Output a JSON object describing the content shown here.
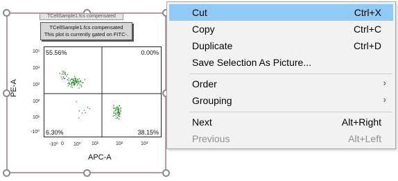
{
  "plot": {
    "header_text": "TCellSample1.fcs compensated",
    "notice_line1": "TCellSample1.fcs compensated",
    "notice_line2": "This plot is currently gated on FITC-.",
    "x_axis_title": "APC-A",
    "y_axis_title": "PE-A",
    "quadrants": {
      "upper_left": "55.56%",
      "upper_right": "0.00%",
      "lower_left": "6.30%",
      "lower_right": "38.15%"
    },
    "x_ticks": [
      "-10⁰",
      "0",
      "10⁰",
      "10¹",
      "10²",
      "10³"
    ],
    "y_ticks": [
      "10⁵",
      "10⁴",
      "10³",
      "10²",
      "10¹",
      "-10⁰"
    ],
    "dot_color": "#2a8a2a",
    "selection_color": "#b89a9e"
  },
  "context_menu": {
    "highlight_color": "#91c9f7",
    "items": [
      {
        "label": "Cut",
        "shortcut": "Ctrl+X"
      },
      {
        "label": "Copy",
        "shortcut": "Ctrl+C"
      },
      {
        "label": "Duplicate",
        "shortcut": "Ctrl+D"
      },
      {
        "label": "Save Selection As Picture..."
      },
      {
        "label": "Order",
        "submenu_arrow": "›"
      },
      {
        "label": "Grouping",
        "submenu_arrow": "›"
      },
      {
        "label": "Next",
        "shortcut": "Alt+Right"
      },
      {
        "label": "Previous",
        "shortcut": "Alt+Left"
      }
    ]
  }
}
